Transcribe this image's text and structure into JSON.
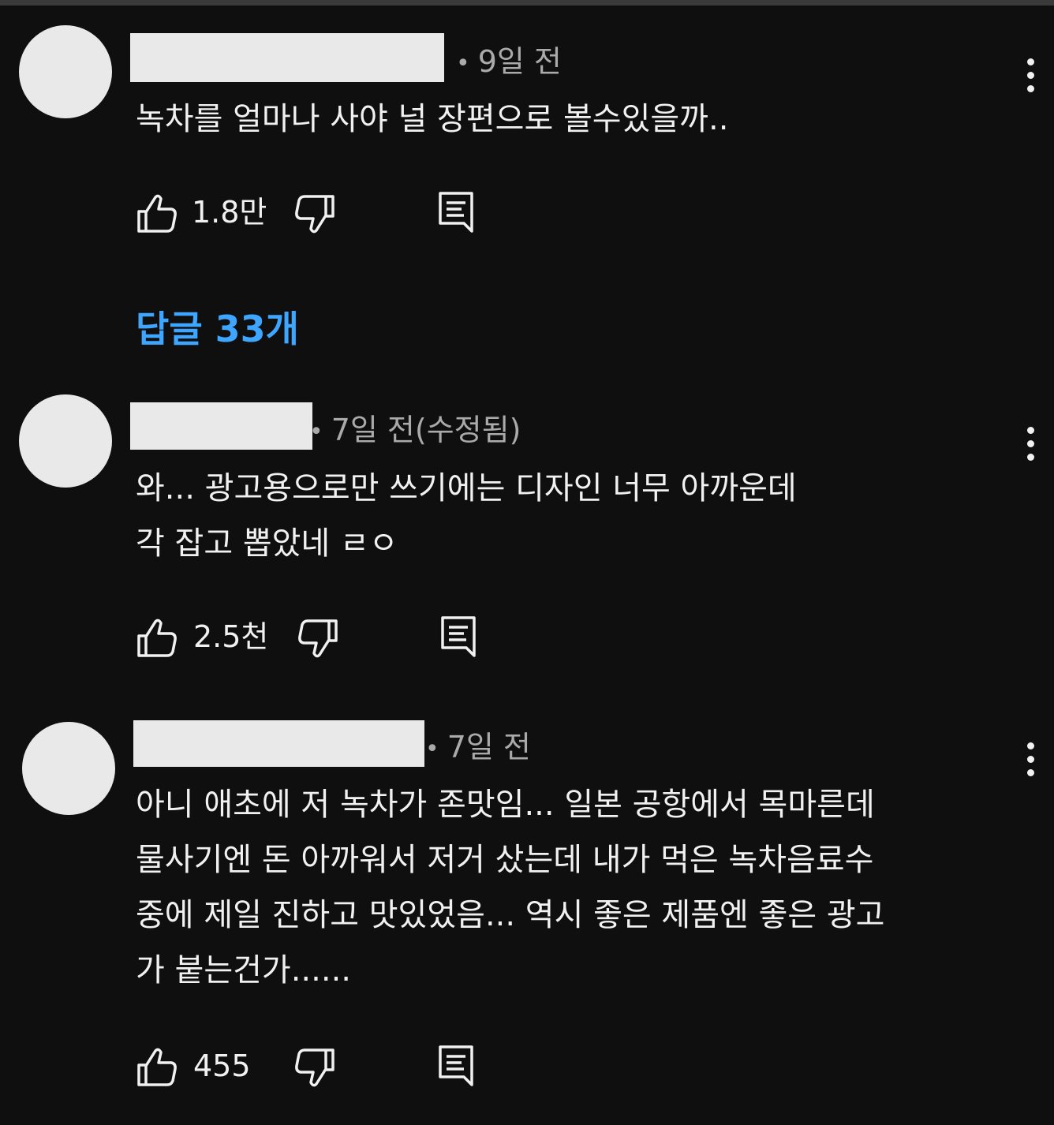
{
  "replies_link": "답글 33개",
  "comments": [
    {
      "timestamp": "9일 전",
      "lines": [
        "녹차를 얼마나 사야 널 장편으로 볼수있을까.."
      ],
      "like_count": "1.8만"
    },
    {
      "timestamp": "7일 전(수정됨)",
      "lines": [
        "와... 광고용으로만 쓰기에는 디자인 너무 아까운데",
        "각 잡고 뽑았네 ㄹㅇ"
      ],
      "like_count": "2.5천"
    },
    {
      "timestamp": "7일 전",
      "lines": [
        "아니 애초에 저 녹차가 존맛임... 일본 공항에서 목마른데",
        "물사기엔 돈 아까워서 저거 샀는데 내가 먹은 녹차음료수",
        "중에 제일 진하고 맛있었음... 역시 좋은 제품엔 좋은 광고",
        "가 붙는건가......"
      ],
      "like_count": "455"
    }
  ],
  "icons": {
    "like": "thumbs-up-icon",
    "dislike": "thumbs-down-icon",
    "reply": "reply-comment-icon",
    "more": "more-vertical-icon"
  },
  "colors": {
    "background": "#0f0f0f",
    "text": "#f1f1f1",
    "meta": "#aaaaaa",
    "link": "#3ea6ff",
    "redaction": "#e9e9e9"
  }
}
